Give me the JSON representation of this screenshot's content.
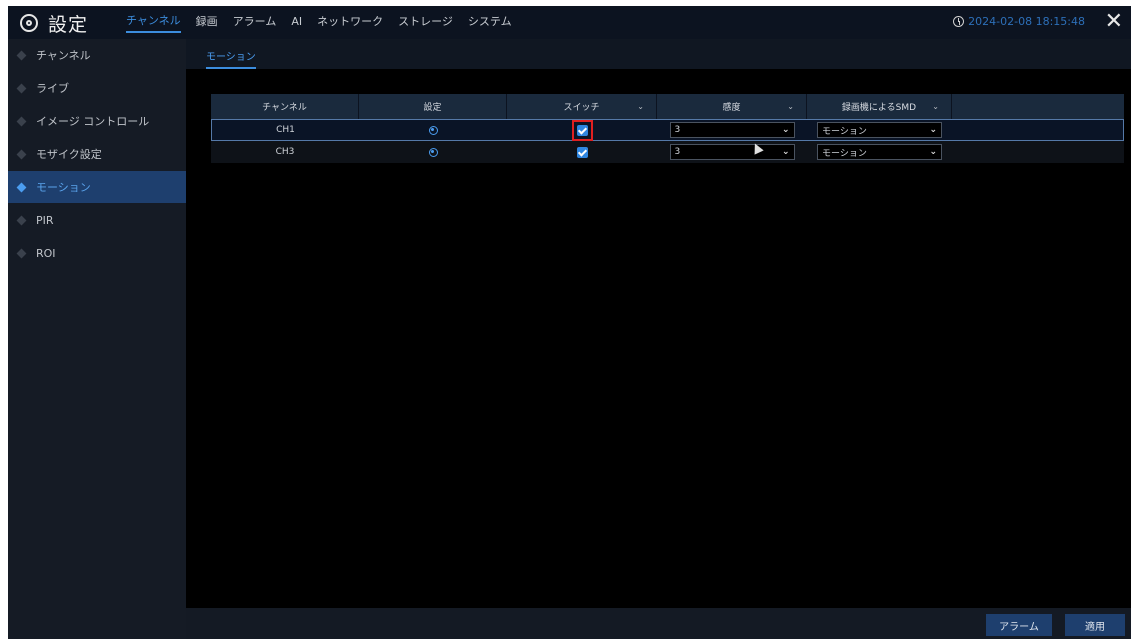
{
  "header": {
    "title": "設定",
    "tabs": [
      "チャンネル",
      "録画",
      "アラーム",
      "AI",
      "ネットワーク",
      "ストレージ",
      "システム"
    ],
    "active_tab": "チャンネル",
    "datetime": "2024-02-08 18:15:48"
  },
  "sidebar": {
    "items": [
      {
        "label": "チャンネル"
      },
      {
        "label": "ライブ"
      },
      {
        "label": "イメージ コントロール"
      },
      {
        "label": "モザイク設定"
      },
      {
        "label": "モーション",
        "active": true
      },
      {
        "label": "PIR"
      },
      {
        "label": "ROI"
      }
    ]
  },
  "subtab": {
    "label": "モーション"
  },
  "table": {
    "headers": {
      "channel": "チャンネル",
      "setting": "設定",
      "switch": "スイッチ",
      "sensitivity": "感度",
      "smd": "録画機によるSMD"
    },
    "rows": [
      {
        "channel": "CH1",
        "switch_checked": true,
        "sensitivity": "3",
        "smd": "モーション",
        "selected": true
      },
      {
        "channel": "CH3",
        "switch_checked": true,
        "sensitivity": "3",
        "smd": "モーション",
        "selected": false
      }
    ]
  },
  "buttons": {
    "alarm": "アラーム",
    "apply": "適用"
  },
  "colors": {
    "accent": "#3c8dde",
    "highlight_box": "#e02020",
    "sidebar_active": "#1e3f6e"
  }
}
